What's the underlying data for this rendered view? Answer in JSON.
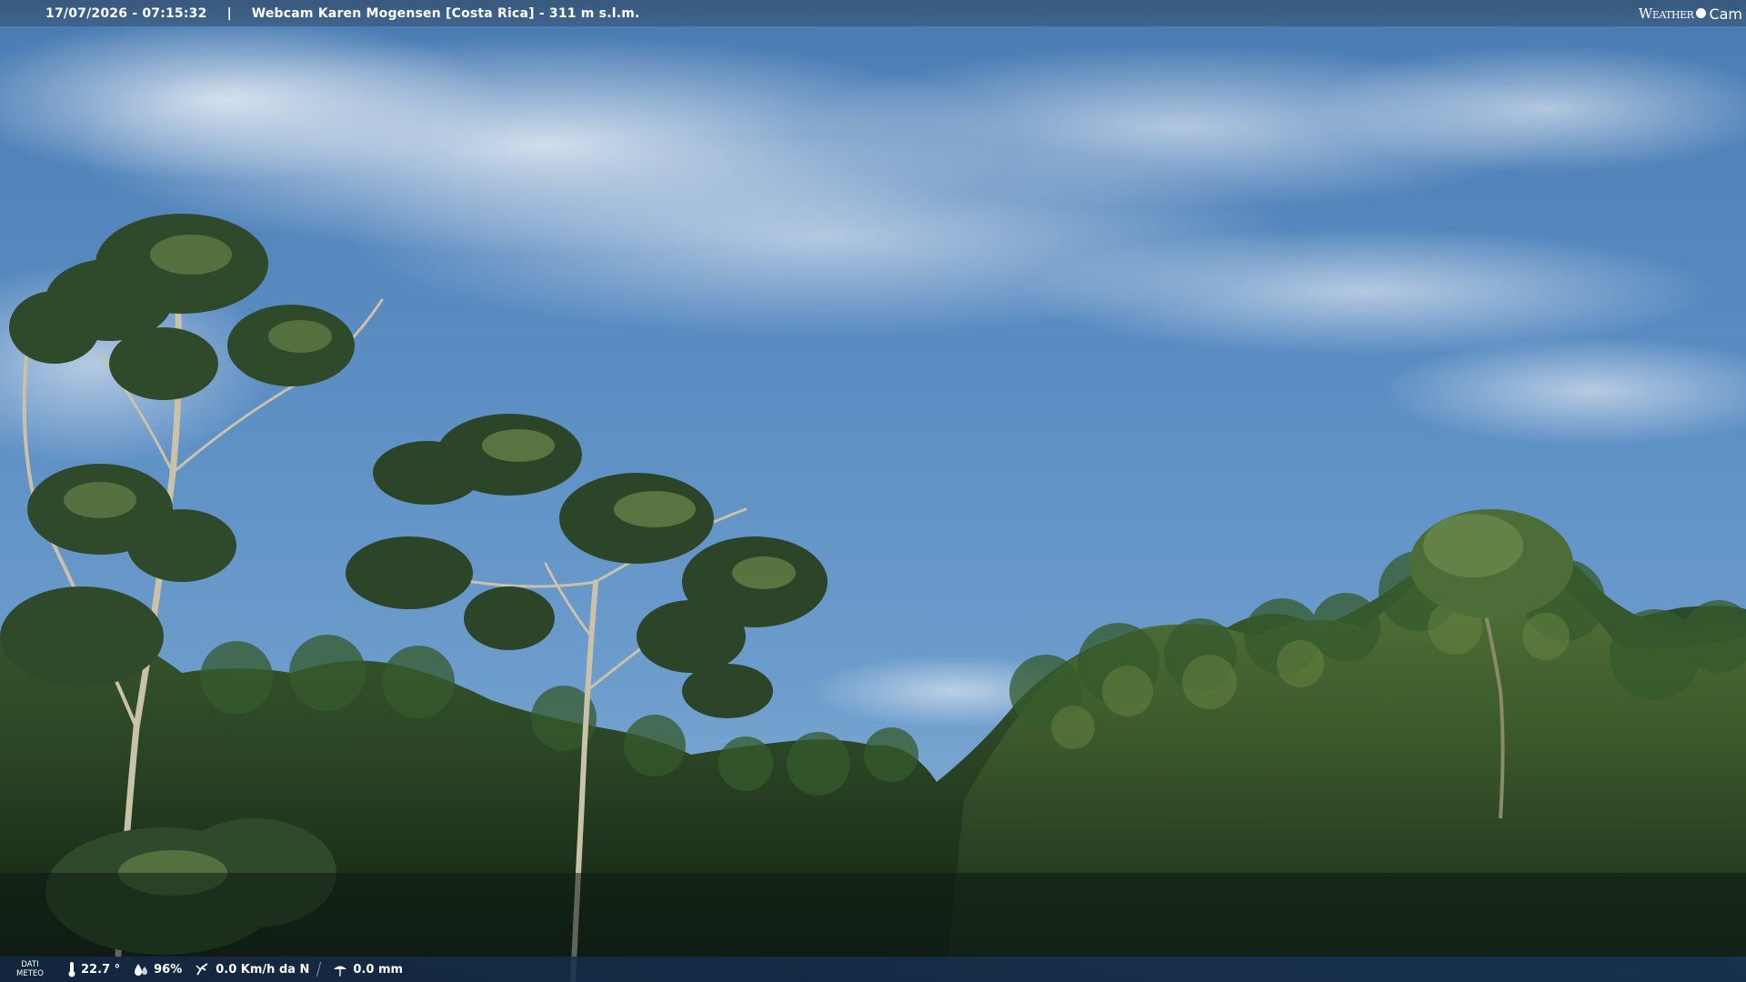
{
  "header": {
    "datetime": "17/07/2026 - 07:15:32",
    "separator": "|",
    "title": "Webcam Karen Mogensen [Costa Rica] - 311 m s.l.m."
  },
  "logo": {
    "word1": "Weather",
    "word2": "Cam",
    "alt": "Weather Cam"
  },
  "footer": {
    "label_line1": "DATI",
    "label_line2": "METEO",
    "temperature": "22.7 °",
    "humidity": "96%",
    "wind": "0.0 Km/h da N",
    "rain": "0.0 mm"
  },
  "colors": {
    "sky_top": "#4f7eb4",
    "sky_bottom": "#8eb4d8",
    "forest_dark": "#14261a",
    "forest_light": "#4a6a34"
  },
  "icons": [
    "thermometer-icon",
    "humidity-drop-icon",
    "wind-icon",
    "rain-icon"
  ]
}
